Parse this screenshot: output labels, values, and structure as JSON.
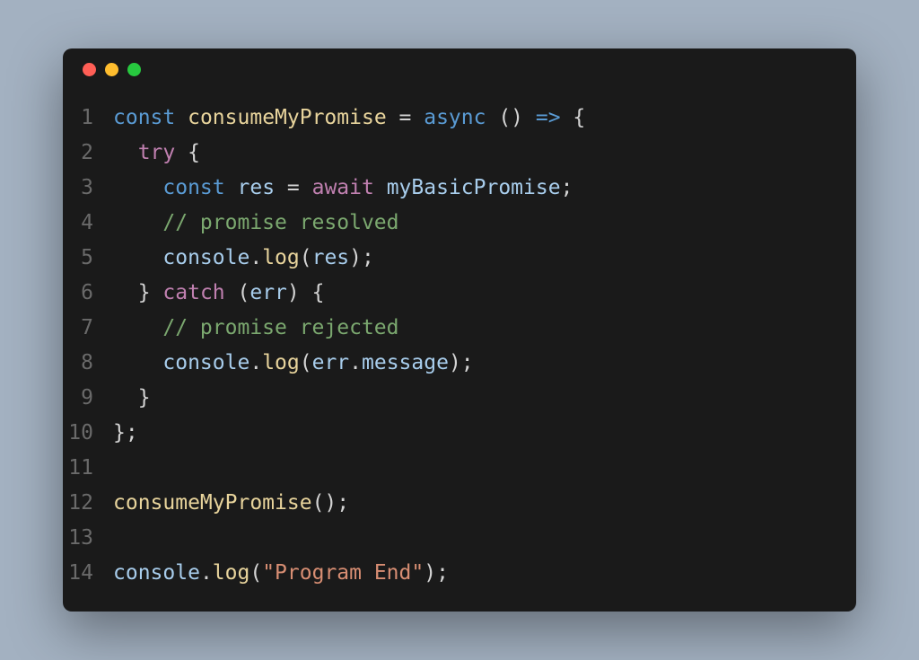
{
  "window": {
    "traffic_lights": [
      "red",
      "yellow",
      "green"
    ]
  },
  "code": {
    "lines": [
      {
        "num": "1"
      },
      {
        "num": "2"
      },
      {
        "num": "3"
      },
      {
        "num": "4"
      },
      {
        "num": "5"
      },
      {
        "num": "6"
      },
      {
        "num": "7"
      },
      {
        "num": "8"
      },
      {
        "num": "9"
      },
      {
        "num": "10"
      },
      {
        "num": "11"
      },
      {
        "num": "12"
      },
      {
        "num": "13"
      },
      {
        "num": "14"
      }
    ],
    "tokens": {
      "l1_const": "const",
      "l1_fn": "consumeMyPromise",
      "l1_eq": " = ",
      "l1_async": "async",
      "l1_parens": " () ",
      "l1_arrow": "=>",
      "l1_brace": " {",
      "l2_indent": "  ",
      "l2_try": "try",
      "l2_brace": " {",
      "l3_indent": "    ",
      "l3_const": "const",
      "l3_sp": " ",
      "l3_res": "res",
      "l3_eq": " = ",
      "l3_await": "await",
      "l3_sp2": " ",
      "l3_promise": "myBasicPromise",
      "l3_semi": ";",
      "l4_indent": "    ",
      "l4_comment": "// promise resolved",
      "l5_indent": "    ",
      "l5_console": "console",
      "l5_dot": ".",
      "l5_log": "log",
      "l5_open": "(",
      "l5_res": "res",
      "l5_close": ");",
      "l6_indent": "  ",
      "l6_closebrace": "} ",
      "l6_catch": "catch",
      "l6_sp": " (",
      "l6_err": "err",
      "l6_closeparens": ") ",
      "l6_brace": "{",
      "l7_indent": "    ",
      "l7_comment": "// promise rejected",
      "l8_indent": "    ",
      "l8_console": "console",
      "l8_dot": ".",
      "l8_log": "log",
      "l8_open": "(",
      "l8_err": "err",
      "l8_dot2": ".",
      "l8_msg": "message",
      "l8_close": ");",
      "l9_indent": "  ",
      "l9_brace": "}",
      "l10_brace": "};",
      "l12_fn": "consumeMyPromise",
      "l12_call": "();",
      "l14_console": "console",
      "l14_dot": ".",
      "l14_log": "log",
      "l14_open": "(",
      "l14_str": "\"Program End\"",
      "l14_close": ");"
    }
  }
}
